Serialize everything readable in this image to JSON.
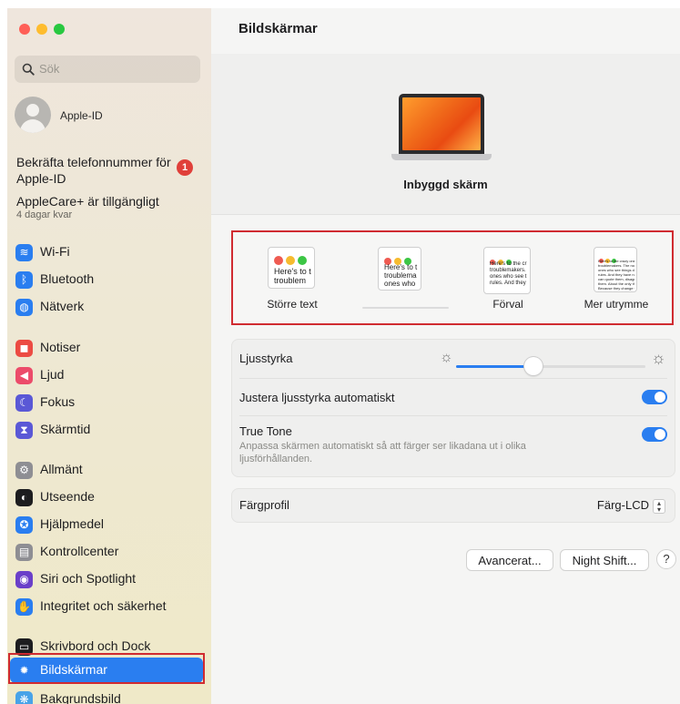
{
  "window": {
    "title": "Bildskärmar"
  },
  "colors": {
    "accent": "#2a7ef0",
    "badge": "#e0403a",
    "highlight": "#d02b31"
  },
  "search": {
    "placeholder": "Sök"
  },
  "apple_id": {
    "label": "Apple-ID"
  },
  "notice": {
    "text": "Bekräfta telefonnummer för Apple-ID",
    "badge": "1"
  },
  "applecare": {
    "title": "AppleCare+ är tillgängligt",
    "subtitle": "4 dagar kvar"
  },
  "sidebar": {
    "items": [
      {
        "label": "Wi-Fi",
        "icon": "wifi-icon",
        "color": "#2a7ef0"
      },
      {
        "label": "Bluetooth",
        "icon": "bluetooth-icon",
        "color": "#2a7ef0"
      },
      {
        "label": "Nätverk",
        "icon": "globe-icon",
        "color": "#2a7ef0"
      },
      {
        "label": "Notiser",
        "icon": "bell-icon",
        "color": "#ec4b43"
      },
      {
        "label": "Ljud",
        "icon": "speaker-icon",
        "color": "#ec4b6a"
      },
      {
        "label": "Fokus",
        "icon": "moon-icon",
        "color": "#5a58d6"
      },
      {
        "label": "Skärmtid",
        "icon": "hourglass-icon",
        "color": "#5a58d6"
      },
      {
        "label": "Allmänt",
        "icon": "gear-icon",
        "color": "#8e8e93"
      },
      {
        "label": "Utseende",
        "icon": "appearance-icon",
        "color": "#1d1d1f"
      },
      {
        "label": "Hjälpmedel",
        "icon": "accessibility-icon",
        "color": "#2a7ef0"
      },
      {
        "label": "Kontrollcenter",
        "icon": "control-center-icon",
        "color": "#8e8e93"
      },
      {
        "label": "Siri och Spotlight",
        "icon": "siri-icon",
        "color": "#6a3fc9"
      },
      {
        "label": "Integritet och säkerhet",
        "icon": "hand-icon",
        "color": "#2a7ef0"
      },
      {
        "label": "Skrivbord och Dock",
        "icon": "dock-icon",
        "color": "#1d1d1f"
      },
      {
        "label": "Bildskärmar",
        "icon": "display-icon",
        "color": "#2a7ef0",
        "selected": true
      },
      {
        "label": "Bakgrundsbild",
        "icon": "wallpaper-icon",
        "color": "#48a3e8"
      }
    ]
  },
  "display": {
    "name": "Inbyggd skärm"
  },
  "resolution_options": [
    {
      "label": "Större text",
      "preview": "Here's to t\ntroublem",
      "selected": false
    },
    {
      "label": "",
      "preview": "Here's to t\ntroublema\nones who",
      "selected": false
    },
    {
      "label": "Förval",
      "preview": "Here's to the cr\ntroublemakers.\nones who see t\nrules. And they",
      "selected": true
    },
    {
      "label": "Mer utrymme",
      "preview": "Here's to the crazy one\ntroublemakers. The roun\nones who see things dif\nrules. And they have no\ncan quote them, disagr\nthem. About the only th\nBecause they change th",
      "selected": false
    }
  ],
  "brightness": {
    "label": "Ljusstyrka",
    "value": 0.41
  },
  "auto_brightness": {
    "label": "Justera ljusstyrka automatiskt",
    "on": true
  },
  "true_tone": {
    "label": "True Tone",
    "description": "Anpassa skärmen automatiskt så att färger ser likadana ut i olika ljusförhållanden.",
    "on": true
  },
  "color_profile": {
    "label": "Färgprofil",
    "value": "Färg-LCD"
  },
  "buttons": {
    "advanced": "Avancerat...",
    "night_shift": "Night Shift...",
    "help": "?"
  }
}
